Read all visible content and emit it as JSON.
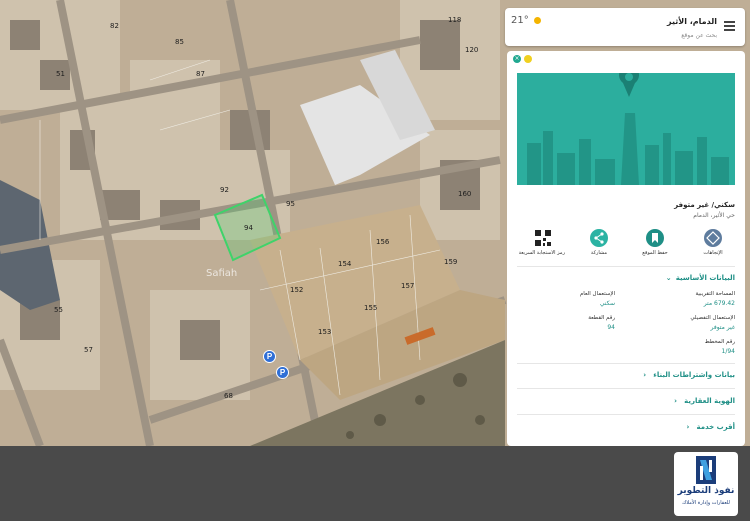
{
  "map": {
    "plot_numbers": [
      "82",
      "85",
      "87",
      "92",
      "94",
      "95",
      "118",
      "120",
      "152",
      "153",
      "154",
      "155",
      "156",
      "157",
      "159",
      "160",
      "51",
      "55",
      "57",
      "68"
    ],
    "street_labels": [
      "Safiah"
    ]
  },
  "top_card": {
    "title": "الدمام، الأثير",
    "search_placeholder": "بحث عن موقع",
    "temperature": "21°",
    "menu_icon": "menu-icon",
    "weather_icon": "sun-icon"
  },
  "panel": {
    "usage_title": "سكني/ غير متوفر",
    "location": "حي الأثير، الدمام",
    "actions": [
      {
        "label": "الإتجاهات",
        "icon": "directions-icon"
      },
      {
        "label": "حفظ الموقع",
        "icon": "bookmark-icon"
      },
      {
        "label": "مشاركة",
        "icon": "share-icon"
      },
      {
        "label": "رمز الاستجابة السريعة",
        "icon": "qr-code-icon"
      }
    ],
    "basic_section_title": "البيانات الأساسية",
    "fields": {
      "area_label": "المساحة التقريبية",
      "area_value": "679.42 متر",
      "general_use_label": "الإستعمال العام",
      "general_use_value": "سكني",
      "detailed_use_label": "الإستعمال التفصيلي",
      "detailed_use_value": "غير متوفر",
      "plot_no_label": "رقم القطعة",
      "plot_no_value": "94",
      "plan_no_label": "رقم المخطط",
      "plan_no_value": "1/94"
    },
    "collapsed_sections": [
      "بيانات واشتراطات البناء",
      "الهوية العقارية",
      "أقرب خدمة"
    ]
  },
  "logo": {
    "name": "نفوذ التطوير",
    "subtitle": "للعقارات وإدارة الأملاك"
  },
  "colors": {
    "accent": "#1f8f86",
    "hero_bg": "#2cae9e",
    "selected_plot": "#3fd36a"
  }
}
